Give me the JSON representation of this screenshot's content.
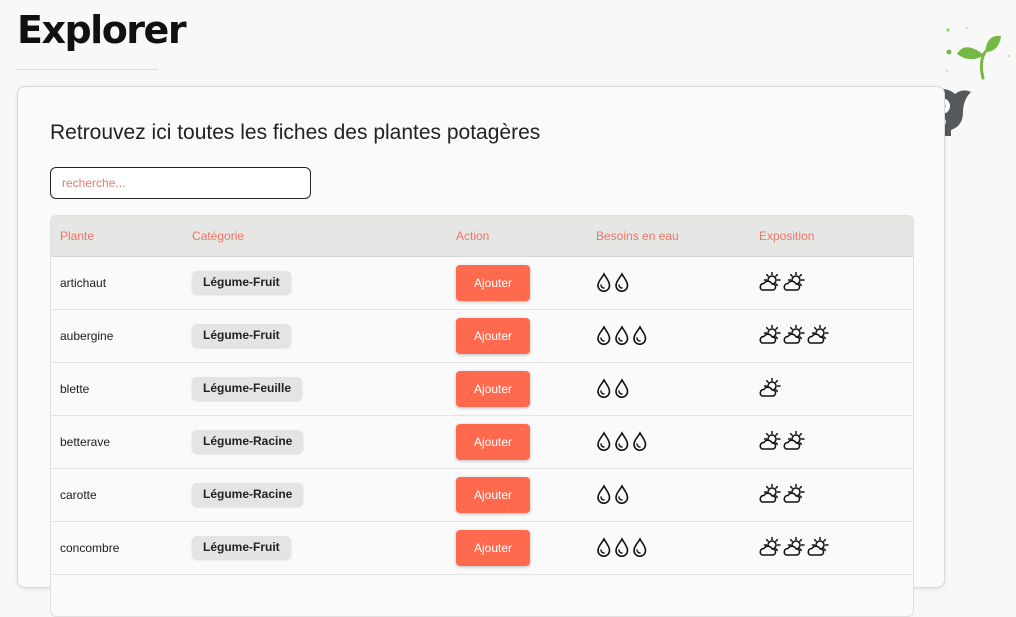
{
  "header": {
    "title": "Explorer"
  },
  "main": {
    "subtitle": "Retrouvez ici toutes les fiches des plantes potagères",
    "search": {
      "placeholder": "recherche...",
      "value": ""
    }
  },
  "table": {
    "columns": [
      "Plante",
      "Catégorie",
      "Action",
      "Besoins en eau",
      "Exposition"
    ],
    "rows": [
      {
        "plant": "artichaut",
        "category": "Légume-Fruit",
        "action": "Ajouter",
        "water": 2,
        "sun": 2
      },
      {
        "plant": "aubergine",
        "category": "Légume-Fruit",
        "action": "Ajouter",
        "water": 3,
        "sun": 3
      },
      {
        "plant": "blette",
        "category": "Légume-Feuille",
        "action": "Ajouter",
        "water": 2,
        "sun": 1
      },
      {
        "plant": "betterave",
        "category": "Légume-Racine",
        "action": "Ajouter",
        "water": 3,
        "sun": 2
      },
      {
        "plant": "carotte",
        "category": "Légume-Racine",
        "action": "Ajouter",
        "water": 2,
        "sun": 2
      },
      {
        "plant": "concombre",
        "category": "Légume-Fruit",
        "action": "Ajouter",
        "water": 3,
        "sun": 3
      }
    ]
  },
  "icons": {
    "water": "water-drop-icon",
    "sun": "sun-cloud-icon",
    "mascot": "mascot-sprout-icon"
  },
  "colors": {
    "accent": "#ff6a4e",
    "header_text": "#ee7467",
    "placeholder": "#e77a6d",
    "table_header_bg": "#e6e6e4"
  }
}
